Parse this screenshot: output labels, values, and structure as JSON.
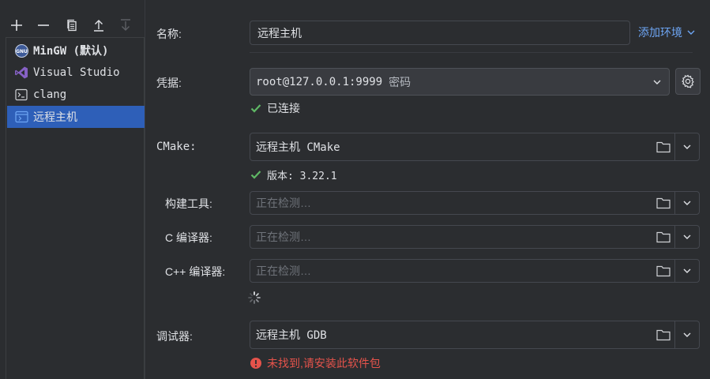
{
  "sidebar": {
    "toolbar": [
      {
        "name": "add-icon"
      },
      {
        "name": "remove-icon"
      },
      {
        "name": "copy-icon"
      },
      {
        "name": "move-up-icon"
      },
      {
        "name": "move-down-icon"
      }
    ],
    "items": [
      {
        "label": "MinGW (默认)",
        "icon": "gnu-icon"
      },
      {
        "label": "Visual Studio",
        "icon": "visual-studio-icon"
      },
      {
        "label": "clang",
        "icon": "terminal-icon"
      },
      {
        "label": "远程主机",
        "icon": "remote-host-icon"
      }
    ]
  },
  "form": {
    "name_label": "名称:",
    "name_value": "远程主机",
    "add_env_label": "添加环境",
    "credentials_label": "凭据:",
    "credentials_value": "root@127.0.0.1:9999",
    "credentials_suffix": "密码",
    "connected_text": "已连接",
    "cmake_label": "CMake:",
    "cmake_value": "远程主机 CMake",
    "cmake_version": "版本: 3.22.1",
    "build_tool_label": "构建工具:",
    "c_compiler_label": "C 编译器:",
    "cpp_compiler_label": "C++ 编译器:",
    "detecting_placeholder": "正在检测…",
    "debugger_label": "调试器:",
    "debugger_value": "远程主机 GDB",
    "debugger_error": "未找到,请安装此软件包"
  },
  "colors": {
    "background": "#2b2d30",
    "selection": "#2e5fb8",
    "link": "#6ea6f5",
    "success": "#5fb865",
    "error": "#e5534b"
  }
}
